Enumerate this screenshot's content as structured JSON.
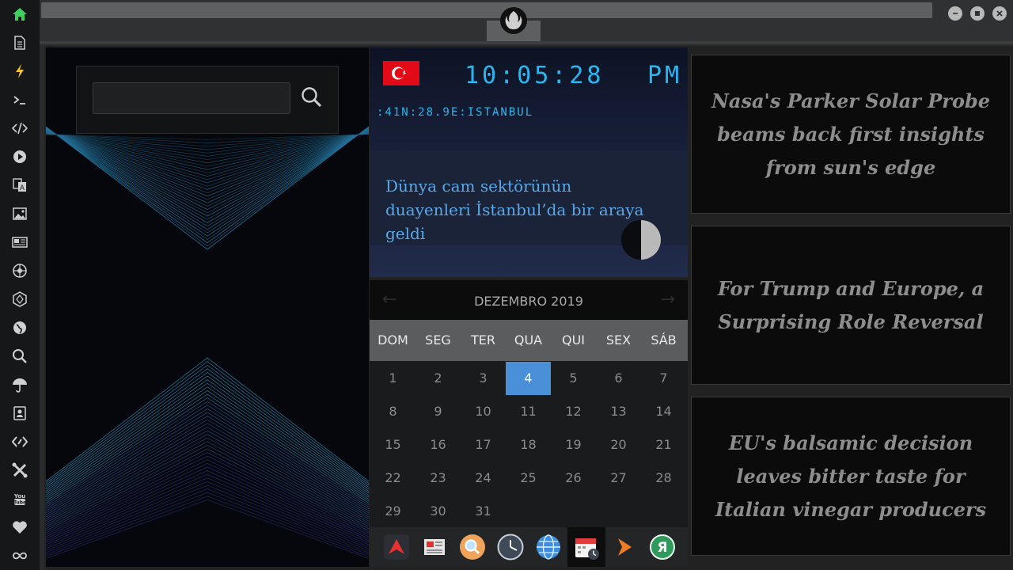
{
  "sidebar": {
    "icons": [
      "home-icon",
      "document-icon",
      "lightning-icon",
      "terminal-icon",
      "code-icon",
      "play-icon",
      "translate-icon",
      "image-icon",
      "news-icon",
      "rebel-emblem-icon",
      "hexagon-icon",
      "globe-icon",
      "search-icon",
      "umbrella-icon",
      "contacts-icon",
      "tag-icon",
      "tools-icon",
      "youtube-icon",
      "heart-icon",
      "infinity-icon"
    ]
  },
  "window": {
    "controls": [
      "minimize",
      "maximize",
      "close"
    ]
  },
  "search": {
    "value": "",
    "placeholder": ""
  },
  "clock": {
    "time": "10:05:28",
    "ampm": "PM",
    "location": ":41N:28.9E:ISTANBUL",
    "country": "Turkey"
  },
  "headline": {
    "text": "Dünya cam sektörünün duayenleri İstanbul’da bir araya geldi"
  },
  "calendar": {
    "month": "DEZEMBRO 2019",
    "prev": "←",
    "next": "→",
    "day_names": [
      "DOM",
      "SEG",
      "TER",
      "QUA",
      "QUI",
      "SEX",
      "SÁB"
    ],
    "weeks": [
      [
        "1",
        "2",
        "3",
        "4",
        "5",
        "6",
        "7"
      ],
      [
        "8",
        "9",
        "10",
        "11",
        "12",
        "13",
        "14"
      ],
      [
        "15",
        "16",
        "17",
        "18",
        "19",
        "20",
        "21"
      ],
      [
        "22",
        "23",
        "24",
        "25",
        "26",
        "27",
        "28"
      ],
      [
        "29",
        "30",
        "31",
        "",
        "",
        "",
        ""
      ]
    ],
    "selected": "4"
  },
  "dock": {
    "apps": [
      "arrow-app-icon",
      "newspaper-app-icon",
      "search-app-icon",
      "clock-app-icon",
      "globe-app-icon",
      "calendar-app-icon",
      "play-app-icon",
      "yandex-app-icon"
    ],
    "active": "calendar-app-icon"
  },
  "news": [
    {
      "title": "Nasa's Parker Solar Probe beams back first insights from sun's edge"
    },
    {
      "title": "For Trump and Europe, a Surprising Role Reversal"
    },
    {
      "title": "EU's balsamic decision leaves bitter taste for Italian vinegar producers"
    }
  ],
  "colors": {
    "accent": "#4a90d9",
    "clock": "#28b7f0",
    "headline": "#59a8e8",
    "sidebar_home": "#3ecf5e",
    "sidebar_lightning": "#f2c12e"
  }
}
